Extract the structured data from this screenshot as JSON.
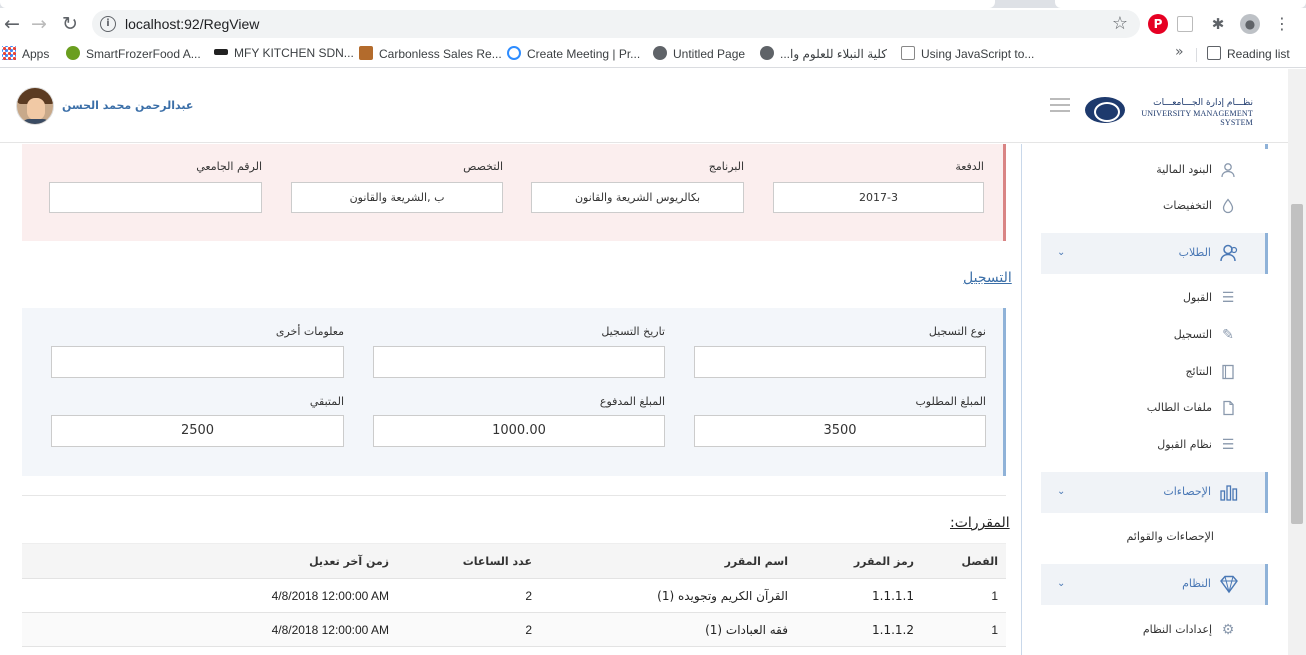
{
  "browser": {
    "url": "localhost:92/RegView",
    "bookmarks": [
      {
        "label": "Apps",
        "color": "#ea4335"
      },
      {
        "label": "SmartFrozerFood A...",
        "color": "#6a9e1f"
      },
      {
        "label": "MFY KITCHEN SDN...",
        "color": "#222222"
      },
      {
        "label": "Carbonless Sales Re...",
        "color": "#b36b2c"
      },
      {
        "label": "Create Meeting | Pr...",
        "color": "#2d8cff"
      },
      {
        "label": "Untitled Page",
        "color": "#5f6368"
      },
      {
        "label": "كلية النبلاء للعلوم وا...",
        "color": "#5f6368"
      },
      {
        "label": "Using JavaScript to...",
        "color": "#888888"
      }
    ],
    "more": "»",
    "reading_list": "Reading list"
  },
  "header": {
    "user_name": "عبدالرحمن محمد الحسن",
    "logo_ar": "نظـــام إدارة الجـــامعـــات",
    "logo_en": "UNIVERSITY MANAGEMENT SYSTEM"
  },
  "student": {
    "batch_label": "الدفعة",
    "batch_value": "2017-3",
    "program_label": "البرنامج",
    "program_value": "بكالريوس الشريعة والقانون",
    "specialization_label": "التخصص",
    "specialization_value": "ب ,الشريعة والقانون",
    "university_id_label": "الرقم الجامعي",
    "university_id_value": ""
  },
  "registration": {
    "section_title": "التسجيل",
    "type_label": "نوع التسجيل",
    "type_value": "",
    "date_label": "تاريخ التسجيل",
    "date_value": "",
    "other_label": "معلومات أخرى",
    "other_value": "",
    "required_label": "المبلغ المطلوب",
    "required_value": "3500",
    "paid_label": "المبلغ المدفوع",
    "paid_value": "1000.00",
    "remaining_label": "المتبقي",
    "remaining_value": "2500"
  },
  "courses": {
    "title": "المقررات:",
    "columns": [
      "الفصل",
      "رمز المقرر",
      "اسم المقرر",
      "عدد الساعات",
      "زمن آخر تعديل"
    ],
    "rows": [
      {
        "semester": "1",
        "code": "1.1.1.1",
        "name": "القرآن الكريم وتجويده (1)",
        "hours": "2",
        "modified": "4/8/2018 12:00:00 AM"
      },
      {
        "semester": "1",
        "code": "1.1.1.2",
        "name": "فقه العبادات (1)",
        "hours": "2",
        "modified": "4/8/2018 12:00:00 AM"
      }
    ]
  },
  "sidebar": {
    "finance_items": [
      {
        "label": "البنود المالية",
        "icon": "users-icon"
      },
      {
        "label": "التخفيضات",
        "icon": "drop-icon"
      }
    ],
    "students_group": "الطلاب",
    "students_items": [
      {
        "label": "القبول",
        "icon": "list-icon"
      },
      {
        "label": "التسجيل",
        "icon": "pencil-icon"
      },
      {
        "label": "النتائج",
        "icon": "book-icon"
      },
      {
        "label": "ملفات الطالب",
        "icon": "file-icon"
      },
      {
        "label": "نظام القبول",
        "icon": "list-icon"
      }
    ],
    "stats_group": "الإحصاءات",
    "stats_items": [
      {
        "label": "الإحصاءات والقوائم"
      }
    ],
    "system_group": "النظام",
    "system_items": [
      {
        "label": "إعدادات النظام",
        "icon": "gear-icon"
      }
    ]
  }
}
